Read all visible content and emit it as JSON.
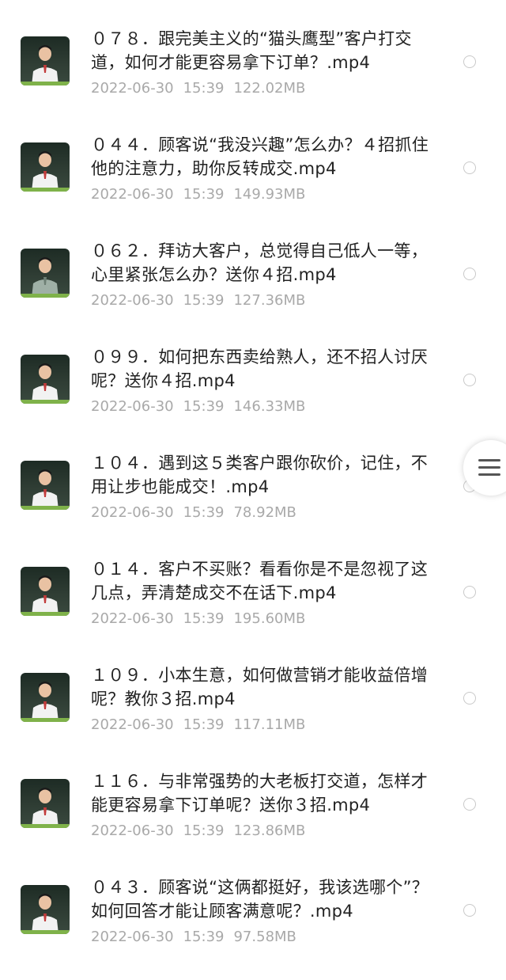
{
  "files": [
    {
      "name": "０７８．跟完美主义的“猫头鹰型”客户打交道，如何才能更容易拿下订单？.mp4",
      "date": "2022-06-30",
      "time": "15:39",
      "size": "122.02MB"
    },
    {
      "name": "０４４．顾客说“我没兴趣”怎么办？４招抓住他的注意力，助你反转成交.mp4",
      "date": "2022-06-30",
      "time": "15:39",
      "size": "149.93MB"
    },
    {
      "name": "０６２．拜访大客户，总觉得自己低人一等，心里紧张怎么办？送你４招.mp4",
      "date": "2022-06-30",
      "time": "15:39",
      "size": "127.36MB"
    },
    {
      "name": "０９９．如何把东西卖给熟人，还不招人讨厌呢？送你４招.mp4",
      "date": "2022-06-30",
      "time": "15:39",
      "size": "146.33MB"
    },
    {
      "name": "１０４．遇到这５类客户跟你砍价，记住，不用让步也能成交！.mp4",
      "date": "2022-06-30",
      "time": "15:39",
      "size": "78.92MB"
    },
    {
      "name": "０１４．客户不买账？看看你是不是忽视了这几点，弄清楚成交不在话下.mp4",
      "date": "2022-06-30",
      "time": "15:39",
      "size": "195.60MB"
    },
    {
      "name": "１０９．小本生意，如何做营销才能收益倍增呢？教你３招.mp4",
      "date": "2022-06-30",
      "time": "15:39",
      "size": "117.11MB"
    },
    {
      "name": "１１６．与非常强势的大老板打交道，怎样才能更容易拿下订单呢？送你３招.mp4",
      "date": "2022-06-30",
      "time": "15:39",
      "size": "123.86MB"
    },
    {
      "name": "０４３．顾客说“这俩都挺好，我该选哪个”？如何回答才能让顾客满意呢？.mp4",
      "date": "2022-06-30",
      "time": "15:39",
      "size": "97.58MB"
    }
  ],
  "icons": {
    "thumbnail": "video-thumbnail-icon",
    "select": "radio-unchecked-icon",
    "menu": "hamburger-menu-icon"
  },
  "colors": {
    "title_text": "#222222",
    "meta_text": "#a9a9a9",
    "radio_border": "#c9c9c9"
  }
}
